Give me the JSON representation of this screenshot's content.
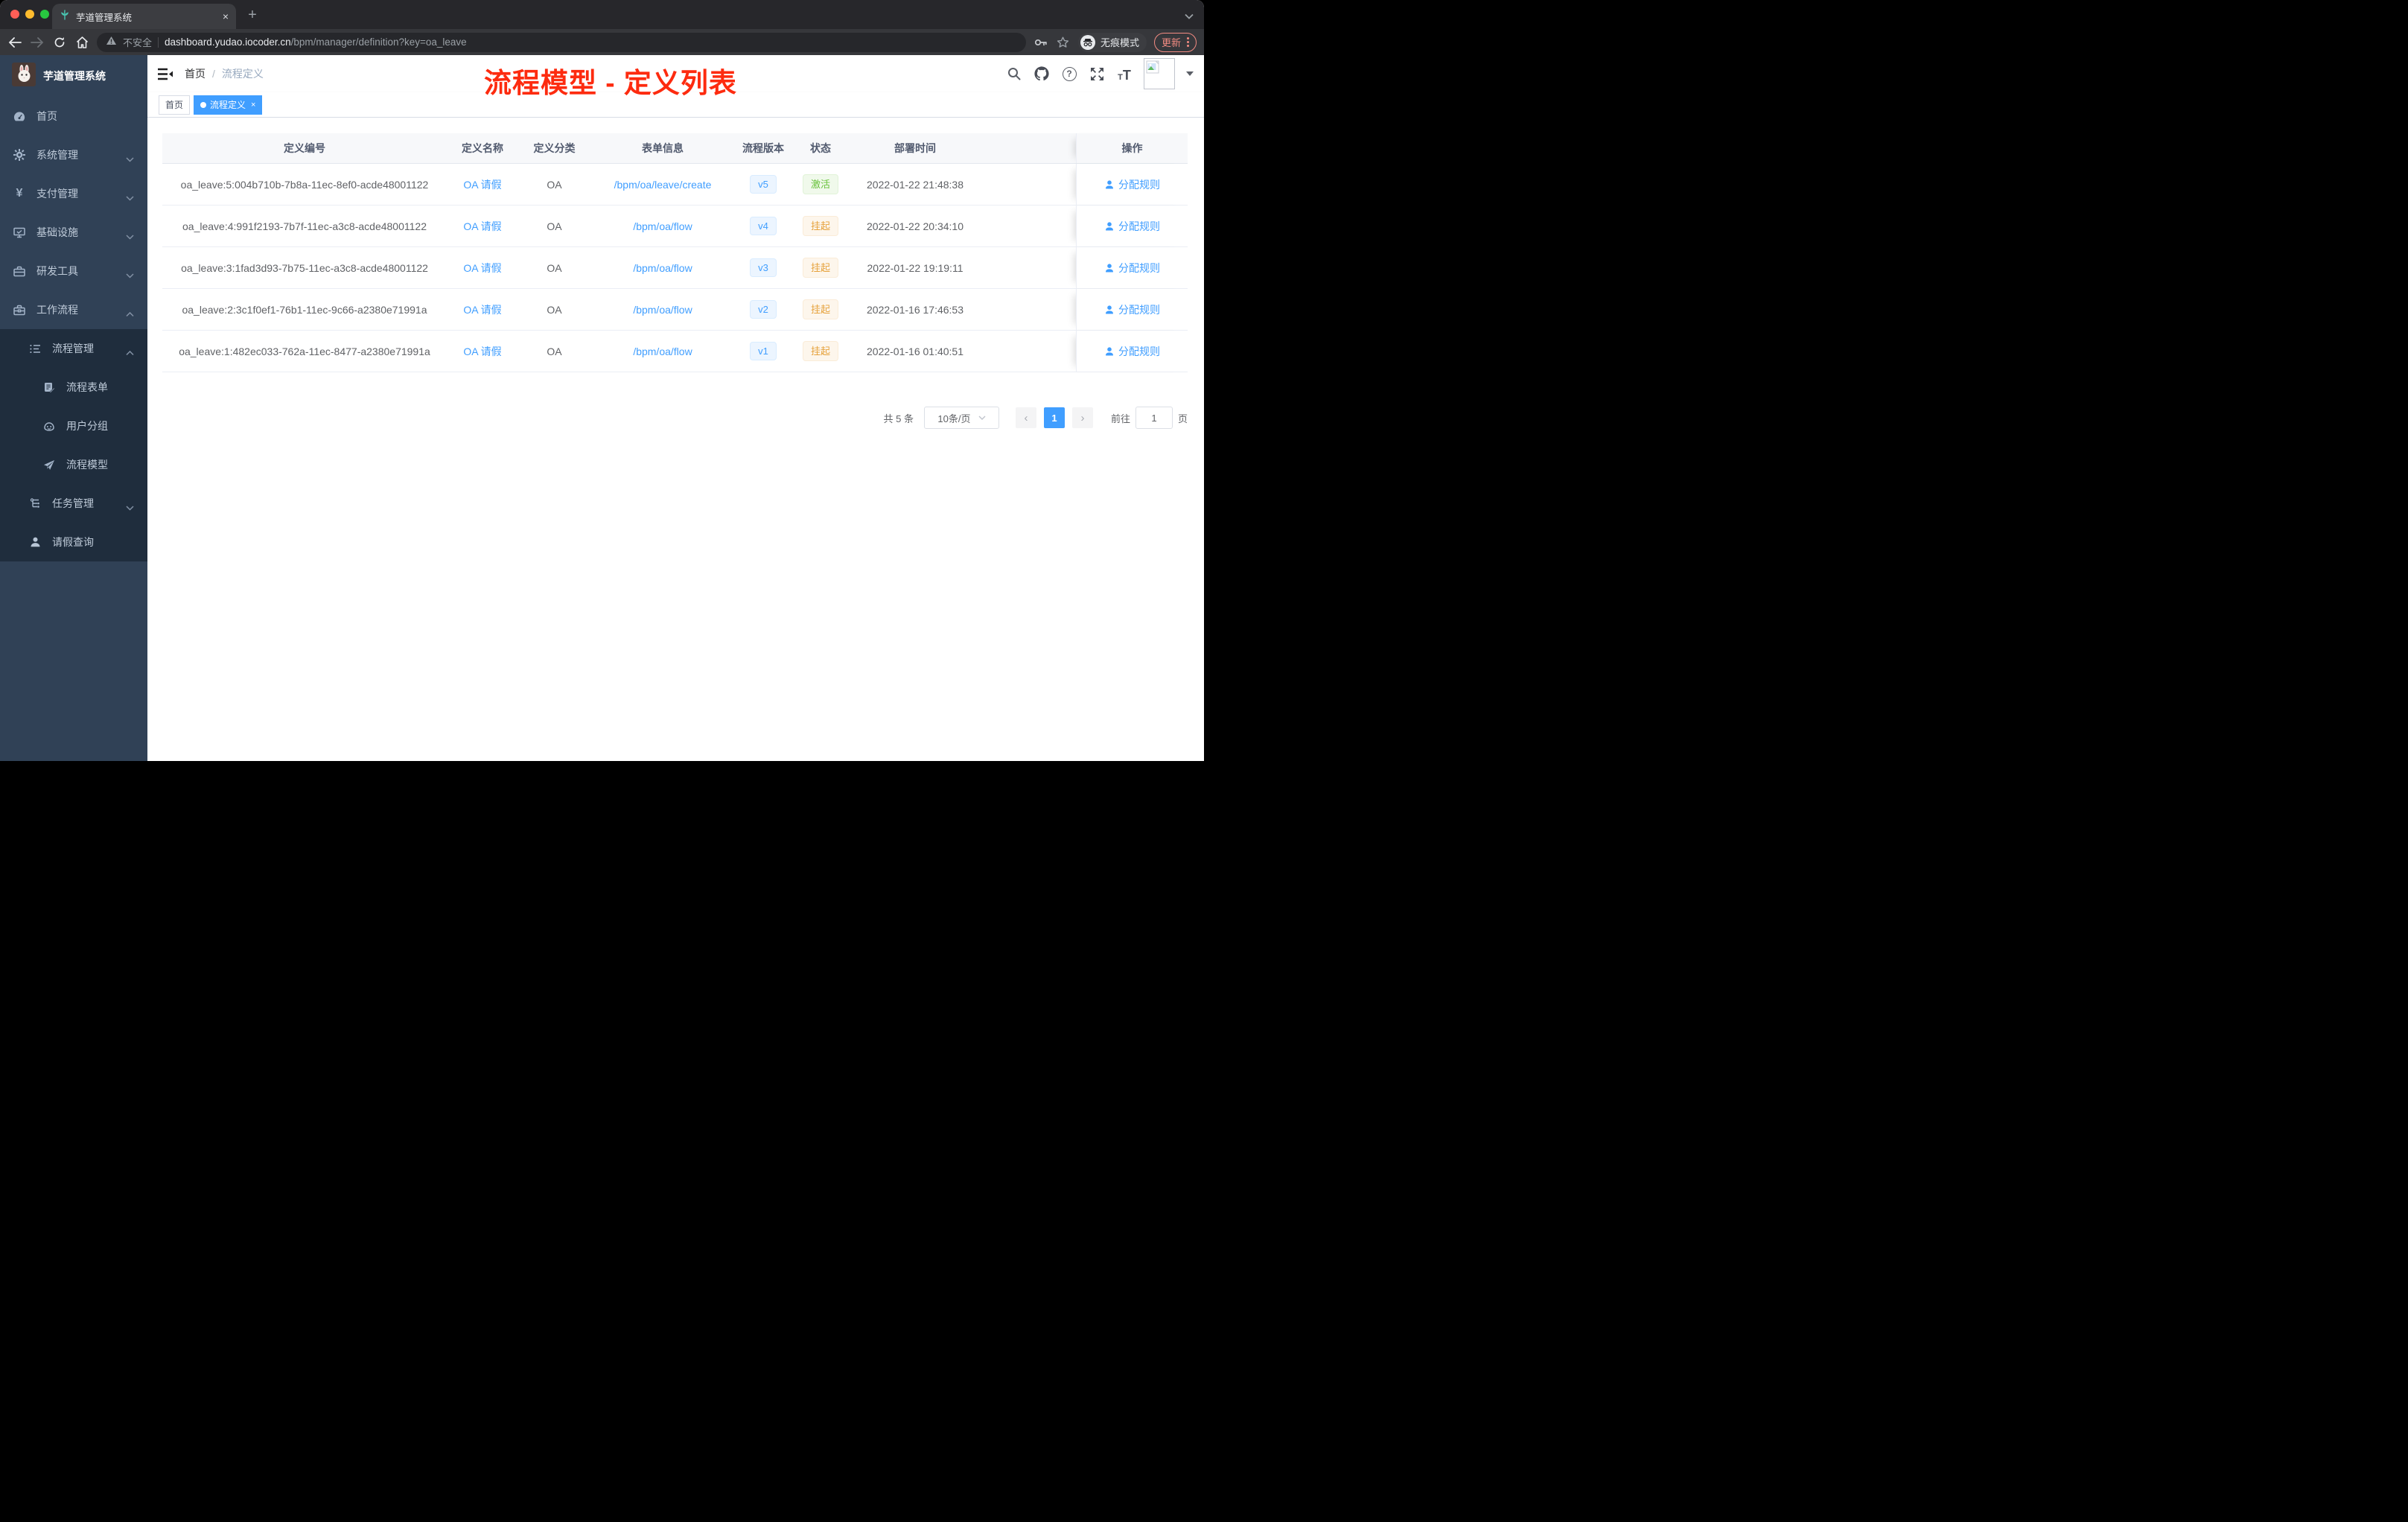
{
  "colors": {
    "primary": "#409eff",
    "sidebar_bg": "#304156",
    "submenu_bg": "#1f2d3d",
    "annotation_red": "#fd2b0f",
    "update_red": "#f28b82",
    "status_active_green": "#67c23a",
    "status_suspend_orange": "#e6a23c"
  },
  "browser": {
    "tab_title": "芋道管理系统",
    "security_label": "不安全",
    "url_domain": "dashboard.yudao.iocoder.cn",
    "url_path": "/bpm/manager/definition?key=oa_leave",
    "incognito_label": "无痕模式",
    "update_label": "更新",
    "new_tab": "+",
    "close_tab": "×"
  },
  "sidebar": {
    "app_title": "芋道管理系统",
    "items": [
      {
        "label": "首页",
        "icon": "dashboard-icon"
      },
      {
        "label": "系统管理",
        "icon": "gear-icon",
        "chevron": "down"
      },
      {
        "label": "支付管理",
        "icon": "yen-icon",
        "chevron": "down"
      },
      {
        "label": "基础设施",
        "icon": "monitor-icon",
        "chevron": "down"
      },
      {
        "label": "研发工具",
        "icon": "toolbox-icon",
        "chevron": "down"
      },
      {
        "label": "工作流程",
        "icon": "briefcase-icon",
        "chevron": "up"
      },
      {
        "label": "流程管理",
        "icon": "list-icon",
        "chevron": "up"
      },
      {
        "label": "流程表单",
        "icon": "form-icon"
      },
      {
        "label": "用户分组",
        "icon": "robot-icon"
      },
      {
        "label": "流程模型",
        "icon": "paper-plane-icon"
      },
      {
        "label": "任务管理",
        "icon": "tree-icon",
        "chevron": "down"
      },
      {
        "label": "请假查询",
        "icon": "person-icon"
      }
    ]
  },
  "navbar": {
    "breadcrumb_home": "首页",
    "breadcrumb_sep": "/",
    "breadcrumb_current": "流程定义",
    "annotation": "流程模型 - 定义列表"
  },
  "tags": {
    "home": "首页",
    "active": "流程定义",
    "close": "×"
  },
  "table": {
    "headers": [
      "定义编号",
      "定义名称",
      "定义分类",
      "表单信息",
      "流程版本",
      "状态",
      "部署时间"
    ],
    "op_header": "操作",
    "action": "分配规则",
    "rows": [
      {
        "id": "oa_leave:5:004b710b-7b8a-11ec-8ef0-acde48001122",
        "name": "OA 请假",
        "category": "OA",
        "form": "/bpm/oa/leave/create",
        "version": "v5",
        "status": {
          "label": "激活",
          "type": "success"
        },
        "time": "2022-01-22 21:48:38"
      },
      {
        "id": "oa_leave:4:991f2193-7b7f-11ec-a3c8-acde48001122",
        "name": "OA 请假",
        "category": "OA",
        "form": "/bpm/oa/flow",
        "version": "v4",
        "status": {
          "label": "挂起",
          "type": "warning"
        },
        "time": "2022-01-22 20:34:10"
      },
      {
        "id": "oa_leave:3:1fad3d93-7b75-11ec-a3c8-acde48001122",
        "name": "OA 请假",
        "category": "OA",
        "form": "/bpm/oa/flow",
        "version": "v3",
        "status": {
          "label": "挂起",
          "type": "warning"
        },
        "time": "2022-01-22 19:19:11"
      },
      {
        "id": "oa_leave:2:3c1f0ef1-76b1-11ec-9c66-a2380e71991a",
        "name": "OA 请假",
        "category": "OA",
        "form": "/bpm/oa/flow",
        "version": "v2",
        "status": {
          "label": "挂起",
          "type": "warning"
        },
        "time": "2022-01-16 17:46:53"
      },
      {
        "id": "oa_leave:1:482ec033-762a-11ec-8477-a2380e71991a",
        "name": "OA 请假",
        "category": "OA",
        "form": "/bpm/oa/flow",
        "version": "v1",
        "status": {
          "label": "挂起",
          "type": "warning"
        },
        "time": "2022-01-16 01:40:51"
      }
    ]
  },
  "pagination": {
    "total": "共 5 条",
    "page_size": "10条/页",
    "prev": "‹",
    "current_page": "1",
    "next": "›",
    "goto_label": "前往",
    "goto_value": "1",
    "unit": "页"
  }
}
